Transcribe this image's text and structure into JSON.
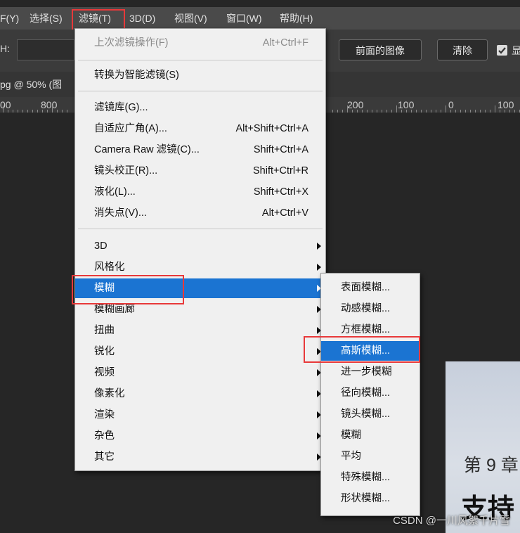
{
  "menubar": {
    "items": [
      "F(Y)",
      "选择(S)",
      "滤镜(T)",
      "3D(D)",
      "视图(V)",
      "窗口(W)",
      "帮助(H)"
    ]
  },
  "options": {
    "h_label": "H:",
    "front_image_button": "前面的图像",
    "clear_button": "清除",
    "show_label": "显"
  },
  "document_tab": {
    "title": "pg @ 50% (图"
  },
  "ruler": {
    "left_labels": [
      "00",
      "800"
    ],
    "right_labels": [
      "200",
      "100",
      "0",
      "100"
    ]
  },
  "filter_menu": {
    "items": [
      {
        "label": "上次滤镜操作(F)",
        "shortcut": "Alt+Ctrl+F",
        "disabled": true
      },
      {
        "label": "转换为智能滤镜(S)",
        "shortcut": ""
      },
      {
        "label": "滤镜库(G)...",
        "shortcut": ""
      },
      {
        "label": "自适应广角(A)...",
        "shortcut": "Alt+Shift+Ctrl+A"
      },
      {
        "label": "Camera Raw 滤镜(C)...",
        "shortcut": "Shift+Ctrl+A"
      },
      {
        "label": "镜头校正(R)...",
        "shortcut": "Shift+Ctrl+R"
      },
      {
        "label": "液化(L)...",
        "shortcut": "Shift+Ctrl+X"
      },
      {
        "label": "消失点(V)...",
        "shortcut": "Alt+Ctrl+V"
      },
      {
        "label": "3D",
        "submenu": true
      },
      {
        "label": "风格化",
        "submenu": true
      },
      {
        "label": "模糊",
        "submenu": true,
        "highlighted": true
      },
      {
        "label": "模糊画廊",
        "submenu": true
      },
      {
        "label": "扭曲",
        "submenu": true
      },
      {
        "label": "锐化",
        "submenu": true
      },
      {
        "label": "视频",
        "submenu": true
      },
      {
        "label": "像素化",
        "submenu": true
      },
      {
        "label": "渲染",
        "submenu": true
      },
      {
        "label": "杂色",
        "submenu": true
      },
      {
        "label": "其它",
        "submenu": true
      }
    ]
  },
  "blur_submenu": {
    "items": [
      {
        "label": "表面模糊..."
      },
      {
        "label": "动感模糊..."
      },
      {
        "label": "方框模糊..."
      },
      {
        "label": "高斯模糊...",
        "highlighted": true
      },
      {
        "label": "进一步模糊"
      },
      {
        "label": "径向模糊..."
      },
      {
        "label": "镜头模糊..."
      },
      {
        "label": "模糊"
      },
      {
        "label": "平均"
      },
      {
        "label": "特殊模糊..."
      },
      {
        "label": "形状模糊..."
      }
    ]
  },
  "document": {
    "chapter_text": "第 9 章",
    "title_text": "支持"
  },
  "watermark": "CSDN @一川风絮千片雪",
  "colors": {
    "highlight": "#1b74d2",
    "annotation_red": "#e8393a",
    "menu_bg": "#f0f0f0"
  }
}
